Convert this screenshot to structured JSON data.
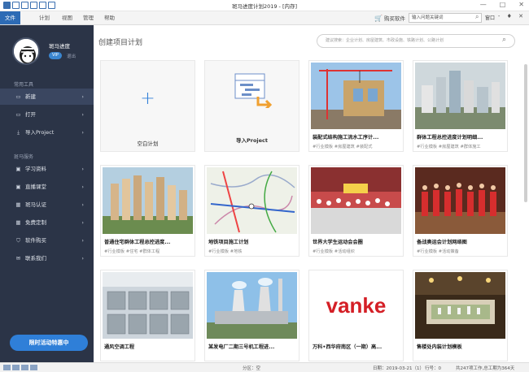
{
  "app": {
    "title": "斑马进度计划2019 - [内存]",
    "window_controls": [
      "—",
      "□",
      "✕"
    ]
  },
  "menu": {
    "tabs": [
      "文件",
      "计划",
      "视图",
      "管理",
      "帮助"
    ],
    "active": 0,
    "cart_label": "购买软件",
    "search_placeholder": "输入问题关键词",
    "window_label": "窗口",
    "right_controls": "- ♦ ✕"
  },
  "sidebar": {
    "user_name": "斑马进度",
    "badge": "VIP",
    "logout": "退出",
    "section_common": "常用工具",
    "section_zebra": "斑马服务",
    "items_common": [
      {
        "label": "新建",
        "icon": "new-icon",
        "glyph": "▭"
      },
      {
        "label": "打开",
        "icon": "folder-icon",
        "glyph": "▭"
      },
      {
        "label": "导入Project",
        "icon": "import-icon",
        "glyph": "⤓"
      }
    ],
    "items_zebra": [
      {
        "label": "学习资料",
        "icon": "book-icon",
        "glyph": "▣"
      },
      {
        "label": "直播课堂",
        "icon": "live-icon",
        "glyph": "▣"
      },
      {
        "label": "斑马认证",
        "icon": "certificate-icon",
        "glyph": "▦"
      },
      {
        "label": "免费定制",
        "icon": "custom-icon",
        "glyph": "▦"
      },
      {
        "label": "软件购买",
        "icon": "cart-icon",
        "glyph": "⛉"
      },
      {
        "label": "联系我们",
        "icon": "mail-icon",
        "glyph": "✉"
      }
    ],
    "selected": "新建",
    "promo_label": "限时活动特惠中"
  },
  "main": {
    "page_title": "创建项目计划",
    "search_placeholder": "建议搜索：企业计划、房屋建筑、市政设施、铁路计划、公路计划"
  },
  "cards": [
    {
      "title": "空白计划",
      "tags": "",
      "kind": "blank"
    },
    {
      "title": "导入Project",
      "tags": "",
      "kind": "import"
    },
    {
      "title": "装配式结构施工流水工序计...",
      "tags": "#行业模板 #房屋建筑 #装配式",
      "kind": "photo",
      "image": "tower-crane"
    },
    {
      "title": "群体工程总控进度计划明细...",
      "tags": "#行业模板 #房屋建筑 #群体施工",
      "kind": "photo",
      "image": "city-aerial"
    },
    {
      "title": "普通住宅群体工程总控进度...",
      "tags": "#行业模板 #住宅 #群体工程",
      "kind": "photo",
      "image": "residential-towers"
    },
    {
      "title": "地铁项目施工计划",
      "tags": "#行业模板 #地铁",
      "kind": "photo",
      "image": "metro-map"
    },
    {
      "title": "世界大学生运动会会圈",
      "tags": "#行业模板 #活动组织",
      "kind": "photo",
      "image": "stadium-crowd"
    },
    {
      "title": "备战奥运会计划网络图",
      "tags": "#行业模板 #活动策备",
      "kind": "photo",
      "image": "athletes-parade"
    },
    {
      "title": "通风空调工程",
      "tags": "",
      "kind": "photo",
      "image": "hvac-units"
    },
    {
      "title": "某发电厂二期三号机工程进...",
      "tags": "",
      "kind": "photo",
      "image": "power-plant"
    },
    {
      "title": "万科•西华府南区（一期）高...",
      "tags": "",
      "kind": "photo",
      "image": "vanke-logo",
      "logo_text": "vanke"
    },
    {
      "title": "售楼处内装计划模板",
      "tags": "",
      "kind": "photo",
      "image": "sales-office"
    }
  ],
  "status": {
    "center": "分区：空",
    "date": "日期：2019-03-21（1）",
    "row": "行号：0",
    "summary": "共247项工作,总工期为364天"
  },
  "colors": {
    "sidebar_bg": "#2b3447",
    "accent": "#2f7fd8",
    "active_tab": "#2d6bb5"
  }
}
